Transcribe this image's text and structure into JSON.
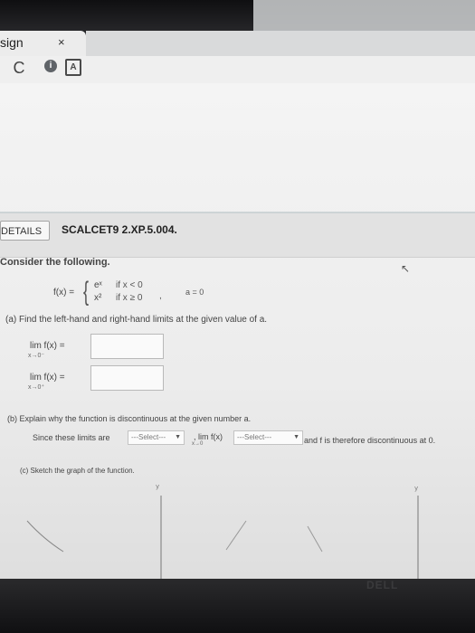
{
  "browser": {
    "tab_title": "sign",
    "tab_close": "×",
    "toolbar": {
      "reload_glyph": "C",
      "info_glyph": "i",
      "ext_glyph": "A"
    }
  },
  "problem": {
    "details_label": "DETAILS",
    "problem_id": "SCALCET9 2.XP.5.004.",
    "intro": "Consider the following.",
    "function": {
      "lhs": "f(x) =",
      "case1_expr": "eˣ",
      "case1_cond": "if x < 0",
      "case2_expr": "x²",
      "case2_cond": "if x ≥ 0",
      "separator": ",",
      "point": "a = 0"
    },
    "part_a": {
      "prompt": "(a) Find the left-hand and right-hand limits at the given value of a.",
      "left_limit": "lim  f(x) =",
      "left_sub": "x→0⁻",
      "right_limit": "lim  f(x) =",
      "right_sub": "x→0⁺",
      "left_value": "",
      "right_value": ""
    },
    "part_b": {
      "prompt": "(b) Explain why the function is discontinuous at the given number a.",
      "since": "Since these limits are",
      "select1": "---Select---",
      "lim_text": ", lim f(x)",
      "lim_sub": "x→0",
      "select2": "---Select---",
      "conclusion": "and f is therefore discontinuous at 0."
    },
    "part_c": {
      "prompt": "(c) Sketch the graph of the function.",
      "y_label": "y"
    }
  },
  "brand": "DELL",
  "colors": {
    "bezel": "#1c1c1e",
    "page_bg": "#efefef",
    "header_bar": "#e2e2e2"
  }
}
